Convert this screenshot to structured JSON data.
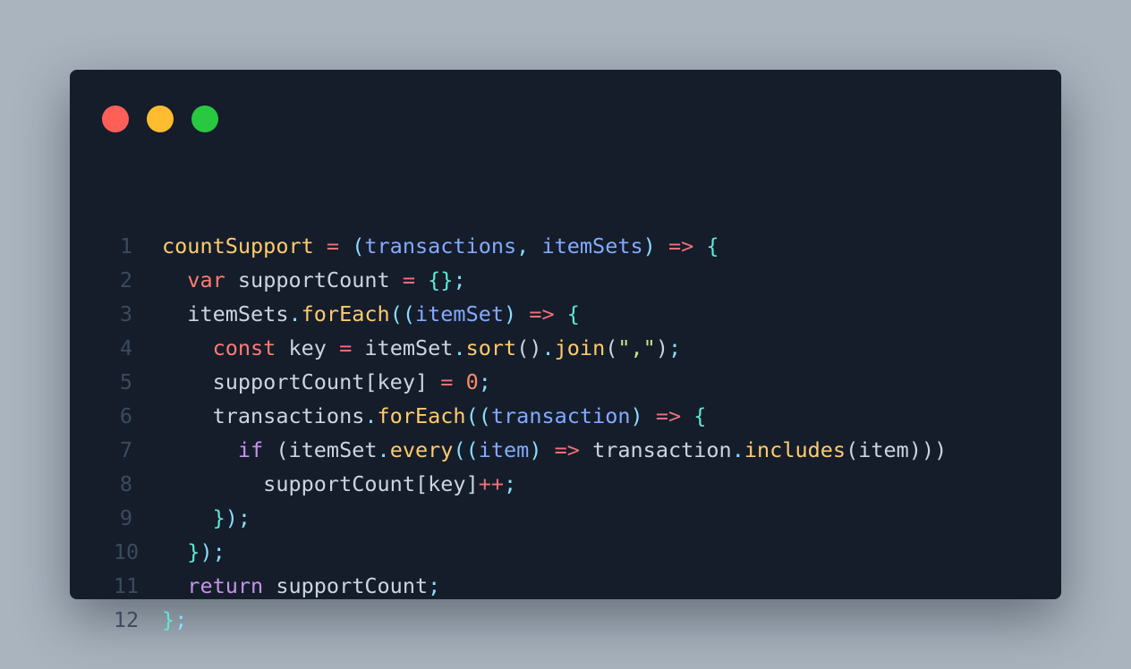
{
  "window": {
    "background": "#151d2b",
    "page_background": "#a9b4bf",
    "traffic_lights": [
      {
        "name": "close",
        "color": "#ff5f57"
      },
      {
        "name": "minimize",
        "color": "#febc2e"
      },
      {
        "name": "maximize",
        "color": "#28c840"
      }
    ]
  },
  "palette": {
    "default": "#cbd5e1",
    "operator": "#f07178",
    "keyword": "#c792ea",
    "function": "#ffcb6b",
    "param": "#82aaff",
    "punct": "#89ddff",
    "brace": "#5eead4",
    "number": "#f78c6c",
    "string": "#c3e88d",
    "storage": "#ff7b72",
    "linenumber": "#3b4a5c"
  },
  "code": {
    "language": "javascript",
    "lines": [
      {
        "number": "1",
        "tokens": [
          {
            "t": "countSupport",
            "c": "function"
          },
          {
            "t": " = ",
            "c": "operator"
          },
          {
            "t": "(",
            "c": "punct"
          },
          {
            "t": "transactions",
            "c": "param"
          },
          {
            "t": ", ",
            "c": "punct"
          },
          {
            "t": "itemSets",
            "c": "param"
          },
          {
            "t": ")",
            "c": "punct"
          },
          {
            "t": " => ",
            "c": "operator"
          },
          {
            "t": "{",
            "c": "brace"
          }
        ]
      },
      {
        "number": "2",
        "tokens": [
          {
            "t": "  ",
            "c": "default"
          },
          {
            "t": "var",
            "c": "storage"
          },
          {
            "t": " supportCount ",
            "c": "default"
          },
          {
            "t": "=",
            "c": "operator"
          },
          {
            "t": " ",
            "c": "default"
          },
          {
            "t": "{}",
            "c": "brace"
          },
          {
            "t": ";",
            "c": "punct"
          }
        ]
      },
      {
        "number": "3",
        "tokens": [
          {
            "t": "  itemSets",
            "c": "default"
          },
          {
            "t": ".",
            "c": "punct"
          },
          {
            "t": "forEach",
            "c": "function"
          },
          {
            "t": "((",
            "c": "punct"
          },
          {
            "t": "itemSet",
            "c": "param"
          },
          {
            "t": ")",
            "c": "punct"
          },
          {
            "t": " => ",
            "c": "operator"
          },
          {
            "t": "{",
            "c": "brace"
          }
        ]
      },
      {
        "number": "4",
        "tokens": [
          {
            "t": "    ",
            "c": "default"
          },
          {
            "t": "const",
            "c": "storage"
          },
          {
            "t": " key ",
            "c": "default"
          },
          {
            "t": "=",
            "c": "operator"
          },
          {
            "t": " itemSet",
            "c": "default"
          },
          {
            "t": ".",
            "c": "punct"
          },
          {
            "t": "sort",
            "c": "function"
          },
          {
            "t": "()",
            "c": "default"
          },
          {
            "t": ".",
            "c": "punct"
          },
          {
            "t": "join",
            "c": "function"
          },
          {
            "t": "(",
            "c": "default"
          },
          {
            "t": "\",\"",
            "c": "string"
          },
          {
            "t": ")",
            "c": "default"
          },
          {
            "t": ";",
            "c": "punct"
          }
        ]
      },
      {
        "number": "5",
        "tokens": [
          {
            "t": "    supportCount",
            "c": "default"
          },
          {
            "t": "[",
            "c": "default"
          },
          {
            "t": "key",
            "c": "default"
          },
          {
            "t": "]",
            "c": "default"
          },
          {
            "t": " = ",
            "c": "operator"
          },
          {
            "t": "0",
            "c": "number"
          },
          {
            "t": ";",
            "c": "punct"
          }
        ]
      },
      {
        "number": "6",
        "tokens": [
          {
            "t": "    transactions",
            "c": "default"
          },
          {
            "t": ".",
            "c": "punct"
          },
          {
            "t": "forEach",
            "c": "function"
          },
          {
            "t": "((",
            "c": "punct"
          },
          {
            "t": "transaction",
            "c": "param"
          },
          {
            "t": ")",
            "c": "punct"
          },
          {
            "t": " => ",
            "c": "operator"
          },
          {
            "t": "{",
            "c": "brace"
          }
        ]
      },
      {
        "number": "7",
        "tokens": [
          {
            "t": "      ",
            "c": "default"
          },
          {
            "t": "if",
            "c": "keyword"
          },
          {
            "t": " (",
            "c": "default"
          },
          {
            "t": "itemSet",
            "c": "default"
          },
          {
            "t": ".",
            "c": "punct"
          },
          {
            "t": "every",
            "c": "function"
          },
          {
            "t": "((",
            "c": "punct"
          },
          {
            "t": "item",
            "c": "param"
          },
          {
            "t": ")",
            "c": "punct"
          },
          {
            "t": " => ",
            "c": "operator"
          },
          {
            "t": "transaction",
            "c": "default"
          },
          {
            "t": ".",
            "c": "punct"
          },
          {
            "t": "includes",
            "c": "function"
          },
          {
            "t": "(",
            "c": "default"
          },
          {
            "t": "item",
            "c": "default"
          },
          {
            "t": ")))",
            "c": "default"
          }
        ]
      },
      {
        "number": "8",
        "tokens": [
          {
            "t": "        supportCount",
            "c": "default"
          },
          {
            "t": "[",
            "c": "default"
          },
          {
            "t": "key",
            "c": "default"
          },
          {
            "t": "]",
            "c": "default"
          },
          {
            "t": "++",
            "c": "operator"
          },
          {
            "t": ";",
            "c": "punct"
          }
        ]
      },
      {
        "number": "9",
        "tokens": [
          {
            "t": "    ",
            "c": "default"
          },
          {
            "t": "}",
            "c": "brace"
          },
          {
            "t": ")",
            "c": "punct"
          },
          {
            "t": ";",
            "c": "punct"
          }
        ]
      },
      {
        "number": "10",
        "tokens": [
          {
            "t": "  ",
            "c": "default"
          },
          {
            "t": "}",
            "c": "brace"
          },
          {
            "t": ")",
            "c": "punct"
          },
          {
            "t": ";",
            "c": "punct"
          }
        ]
      },
      {
        "number": "11",
        "tokens": [
          {
            "t": "  ",
            "c": "default"
          },
          {
            "t": "return",
            "c": "keyword"
          },
          {
            "t": " supportCount",
            "c": "default"
          },
          {
            "t": ";",
            "c": "punct"
          }
        ]
      },
      {
        "number": "12",
        "tokens": [
          {
            "t": "}",
            "c": "brace"
          },
          {
            "t": ";",
            "c": "punct"
          }
        ]
      }
    ]
  }
}
